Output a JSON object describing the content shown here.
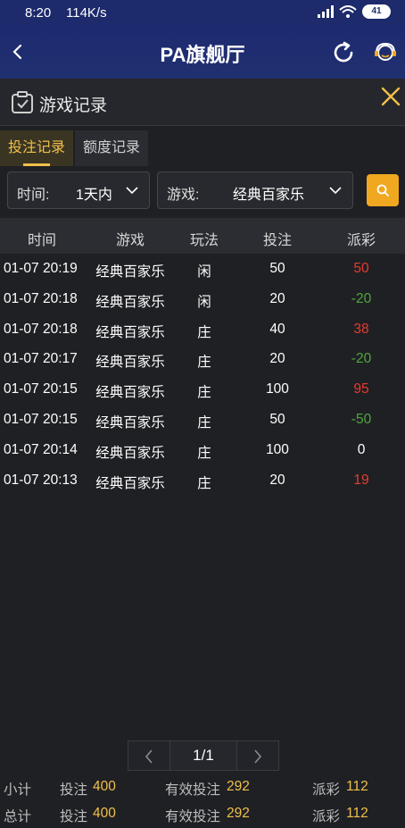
{
  "status": {
    "time": "8:20",
    "speed": "114K/s",
    "battery": "41"
  },
  "appbar": {
    "title": "PA旗舰厅"
  },
  "panel": {
    "title": "游戏记录"
  },
  "tabs": [
    {
      "label": "投注记录",
      "active": true
    },
    {
      "label": "额度记录",
      "active": false
    }
  ],
  "filters": {
    "time_label": "时间:",
    "time_value": "1天内",
    "game_label": "游戏:",
    "game_value": "经典百家乐"
  },
  "table": {
    "headers": [
      "时间",
      "游戏",
      "玩法",
      "投注",
      "派彩"
    ],
    "rows": [
      [
        "01-07 20:19",
        "经典百家乐",
        "闲",
        "50",
        "50"
      ],
      [
        "01-07 20:18",
        "经典百家乐",
        "闲",
        "20",
        "-20"
      ],
      [
        "01-07 20:18",
        "经典百家乐",
        "庄",
        "40",
        "38"
      ],
      [
        "01-07 20:17",
        "经典百家乐",
        "庄",
        "20",
        "-20"
      ],
      [
        "01-07 20:15",
        "经典百家乐",
        "庄",
        "100",
        "95"
      ],
      [
        "01-07 20:15",
        "经典百家乐",
        "庄",
        "50",
        "-50"
      ],
      [
        "01-07 20:14",
        "经典百家乐",
        "庄",
        "100",
        "0"
      ],
      [
        "01-07 20:13",
        "经典百家乐",
        "庄",
        "20",
        "19"
      ]
    ]
  },
  "pager": {
    "page": "1/1"
  },
  "subtotal": {
    "label": "小计",
    "bet_label": "投注",
    "bet": "400",
    "valid_label": "有效投注",
    "valid": "292",
    "payout_label": "派彩",
    "payout": "112"
  },
  "total": {
    "label": "总计",
    "bet_label": "投注",
    "bet": "400",
    "valid_label": "有效投注",
    "valid": "292",
    "payout_label": "派彩",
    "payout": "112"
  },
  "colors": {
    "accent": "#f0c04a",
    "win": "#e53b2f",
    "loss": "#4fa83a",
    "header": "#1e2a70"
  }
}
